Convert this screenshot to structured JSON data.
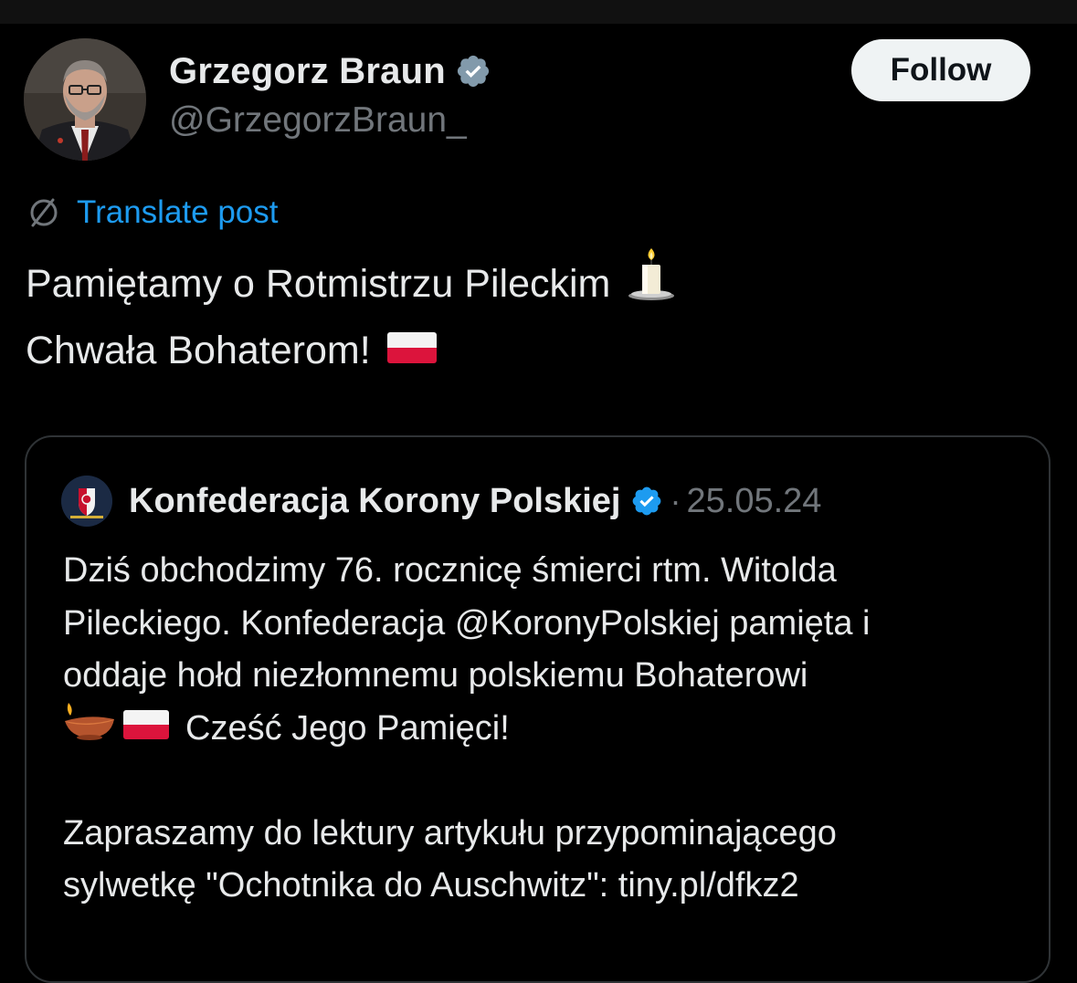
{
  "author": {
    "display_name": "Grzegorz Braun",
    "handle": "@GrzegorzBraun_",
    "verified_icon": "verified-badge-gray"
  },
  "actions": {
    "follow_label": "Follow"
  },
  "translate": {
    "icon": "globe-slash-icon",
    "label": "Translate post"
  },
  "post": {
    "lines": [
      {
        "text": "Pamiętamy o Rotmistrzu Pileckim",
        "emoji": "candle-icon"
      },
      {
        "text": "Chwała Bohaterom!",
        "emoji": "poland-flag-icon"
      }
    ]
  },
  "quote": {
    "author": {
      "display_name": "Konfederacja Korony Polskiej",
      "verified_icon": "verified-badge-blue",
      "separator": "·",
      "date": "25.05.24"
    },
    "lines": [
      "Dziś obchodzimy 76. rocznicę śmierci rtm. Witolda",
      "Pileckiego. Konfederacja @KoronyPolskiej pamięta i",
      "oddaje hołd niezłomnemu polskiemu Bohaterowi",
      "Cześć Jego Pamięci!",
      "",
      "Zapraszamy do lektury artykułu przypominającego",
      "sylwetkę \"Ochotnika do Auschwitz\": tiny.pl/dfkz2"
    ],
    "line4_emojis": [
      "oil-lamp-icon",
      "poland-flag-icon"
    ]
  },
  "colors": {
    "background": "#000000",
    "text_primary": "#e7e9ea",
    "text_secondary": "#71767b",
    "link_blue": "#1d9bf0",
    "verified_blue": "#1d9bf0",
    "border": "#2f3336"
  }
}
